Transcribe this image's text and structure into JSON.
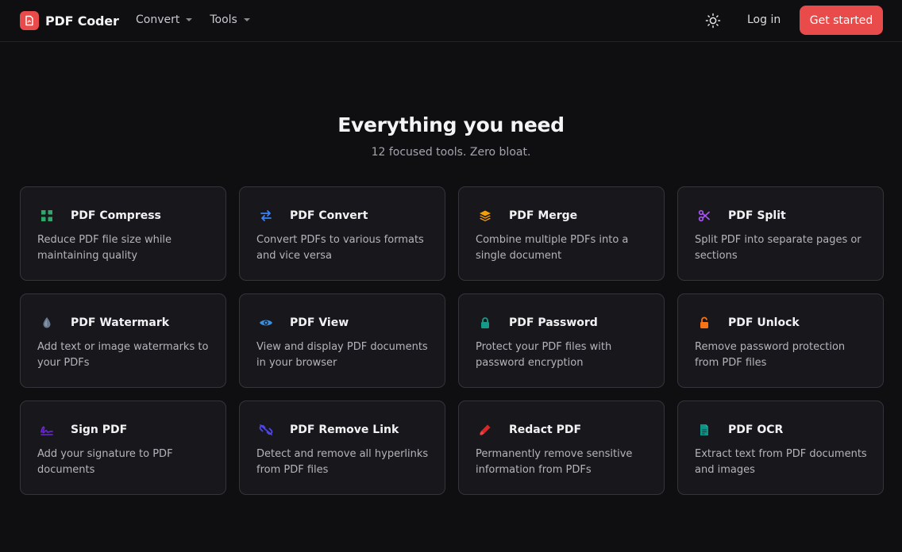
{
  "header": {
    "brand": "PDF Coder",
    "nav": [
      {
        "label": "Convert"
      },
      {
        "label": "Tools"
      }
    ],
    "login_label": "Log in",
    "cta_label": "Get started"
  },
  "hero": {
    "title": "Everything you need",
    "subtitle": "12 focused tools. Zero bloat."
  },
  "tools": [
    {
      "title": "PDF Compress",
      "desc": "Reduce PDF file size while maintaining quality",
      "icon": "compress-icon",
      "color": "#2ea86a"
    },
    {
      "title": "PDF Convert",
      "desc": "Convert PDFs to various formats and vice versa",
      "icon": "convert-arrows-icon",
      "color": "#3b82f6"
    },
    {
      "title": "PDF Merge",
      "desc": "Combine multiple PDFs into a single document",
      "icon": "layers-icon",
      "color": "#f59e0b"
    },
    {
      "title": "PDF Split",
      "desc": "Split PDF into separate pages or sections",
      "icon": "scissors-icon",
      "color": "#a855f7"
    },
    {
      "title": "PDF Watermark",
      "desc": "Add text or image watermarks to your PDFs",
      "icon": "droplet-icon",
      "color": "#6b7a8f"
    },
    {
      "title": "PDF View",
      "desc": "View and display PDF documents in your browser",
      "icon": "eye-icon",
      "color": "#3b8de0"
    },
    {
      "title": "PDF Password",
      "desc": "Protect your PDF files with password encryption",
      "icon": "lock-icon",
      "color": "#159a8a"
    },
    {
      "title": "PDF Unlock",
      "desc": "Remove password protection from PDF files",
      "icon": "unlock-icon",
      "color": "#f97316"
    },
    {
      "title": "Sign PDF",
      "desc": "Add your signature to PDF documents",
      "icon": "signature-icon",
      "color": "#6d28d9"
    },
    {
      "title": "PDF Remove Link",
      "desc": "Detect and remove all hyperlinks from PDF files",
      "icon": "unlink-icon",
      "color": "#4f46e5"
    },
    {
      "title": "Redact PDF",
      "desc": "Permanently remove sensitive information from PDFs",
      "icon": "marker-icon",
      "color": "#dc2626"
    },
    {
      "title": "PDF OCR",
      "desc": "Extract text from PDF documents and images",
      "icon": "document-text-icon",
      "color": "#0d9488"
    }
  ]
}
